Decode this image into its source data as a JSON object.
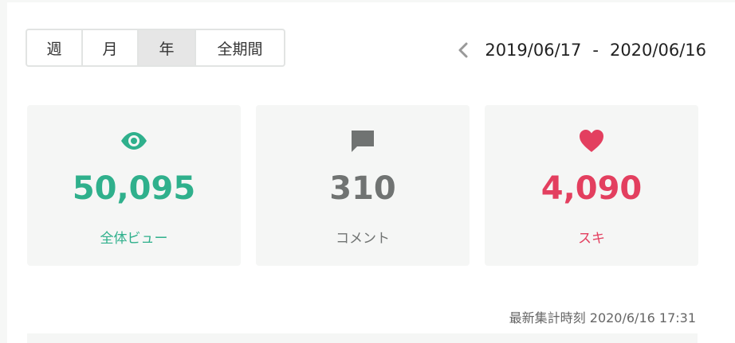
{
  "period_tabs": [
    {
      "label": "週",
      "active": false
    },
    {
      "label": "月",
      "active": false
    },
    {
      "label": "年",
      "active": true
    },
    {
      "label": "全期間",
      "active": false
    }
  ],
  "date_range": {
    "start": "2019/06/17",
    "separator": "-",
    "end": "2020/06/16",
    "prev_icon": "chevron-left-icon"
  },
  "stats": {
    "views": {
      "value": "50,095",
      "label": "全体ビュー",
      "color": "#2fb08c",
      "icon": "eye-icon"
    },
    "comments": {
      "value": "310",
      "label": "コメント",
      "color": "#707372",
      "icon": "comment-icon"
    },
    "likes": {
      "value": "4,090",
      "label": "スキ",
      "color": "#e33f5f",
      "icon": "heart-icon"
    }
  },
  "updated": {
    "label": "最新集計時刻",
    "timestamp": "2020/6/16 17:31"
  }
}
